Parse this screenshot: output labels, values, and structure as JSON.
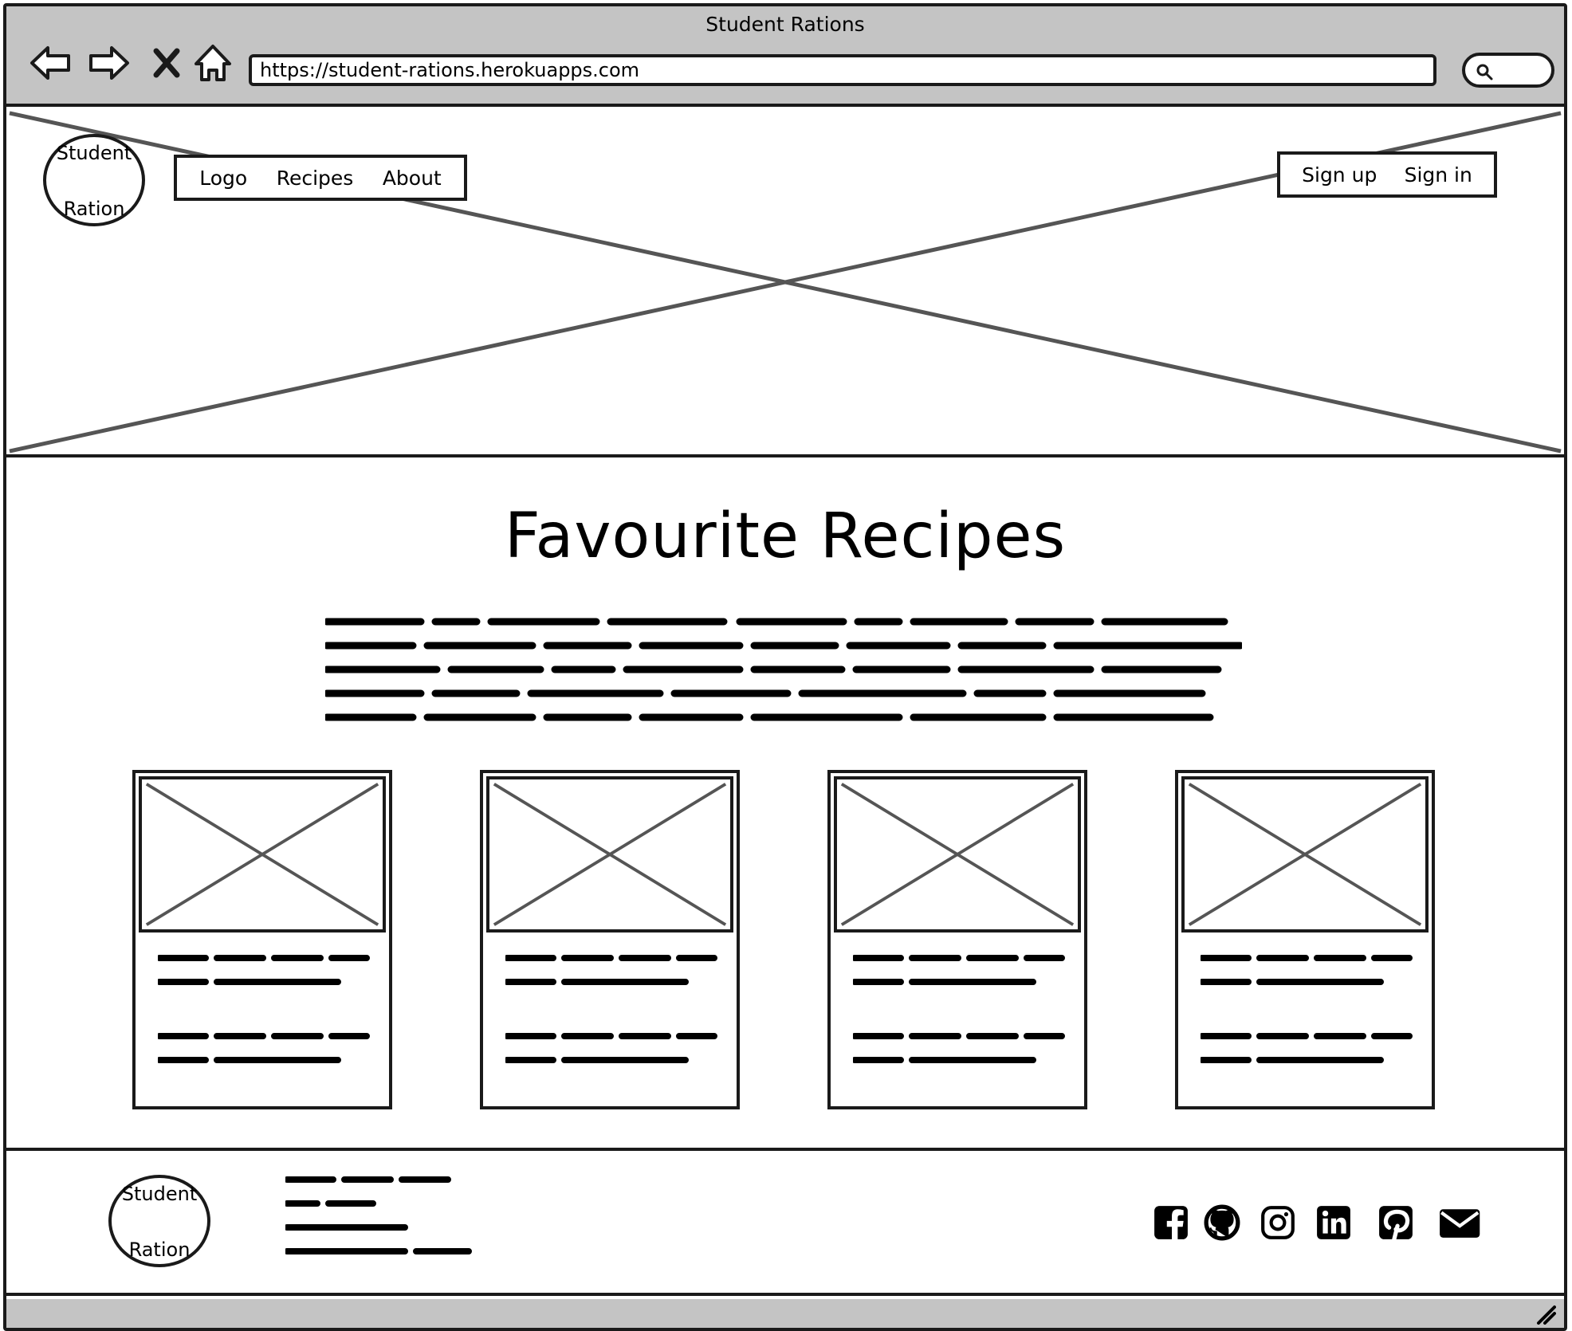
{
  "browser": {
    "title": "Student Rations",
    "url": "https://student-rations.herokuapps.com",
    "icons": [
      "back-arrow-icon",
      "forward-arrow-icon",
      "close-icon",
      "home-icon",
      "search-icon"
    ]
  },
  "header": {
    "logo_line1": "Student",
    "logo_line2": "Ration",
    "nav": [
      "Logo",
      "Recipes",
      "About"
    ],
    "auth": [
      "Sign up",
      "Sign in"
    ]
  },
  "main": {
    "title": "Favourite Recipes",
    "card_count": 4
  },
  "footer": {
    "logo_line1": "Student",
    "logo_line2": "Ration",
    "social_icons": [
      "facebook-icon",
      "github-icon",
      "instagram-icon",
      "linkedin-icon",
      "pinterest-icon",
      "email-icon"
    ]
  },
  "colors": {
    "chrome_gray": "#c4c4c4",
    "stroke": "#1a1a1a",
    "placeholder_line": "#555555"
  }
}
